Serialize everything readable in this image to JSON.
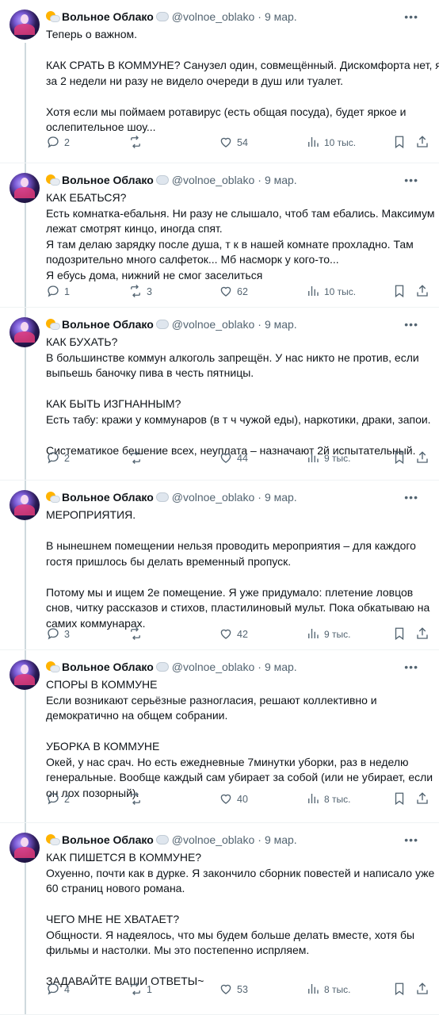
{
  "tweets": [
    {
      "author": "Вольное Облако",
      "handle": "@volnoe_oblako",
      "sep": "·",
      "date": "9 мар.",
      "lines": [
        "Теперь о важном.",
        "",
        "КАК СРАТЬ В КОММУНЕ? Санузел один, совмещённый. Дискомфорта нет, я",
        "за 2 недели ни разу не видело очереди в душ или туалет.",
        "",
        "Хотя если мы поймаем ротавирус (есть общая посуда), будет яркое и",
        "ослепительное шоу..."
      ],
      "replies": "2",
      "retweets": "",
      "likes": "54",
      "views": "10 тыс."
    },
    {
      "author": "Вольное Облако",
      "handle": "@volnoe_oblako",
      "sep": "·",
      "date": "9 мар.",
      "lines": [
        "КАК ЕБАТЬСЯ?",
        "Есть комнатка-ебальня. Ни разу не слышало, чтоб там ебались. Максимум",
        "лежат смотрят кинцо, иногда спят.",
        "Я там делаю зарядку после душа, т к в нашей комнате прохладно. Там",
        "подозрительно много салфеток... Мб насморк у кого-то...",
        "Я ебусь дома, нижний не смог заселиться"
      ],
      "replies": "1",
      "retweets": "3",
      "likes": "62",
      "views": "10 тыс."
    },
    {
      "author": "Вольное Облако",
      "handle": "@volnoe_oblako",
      "sep": "·",
      "date": "9 мар.",
      "lines": [
        "КАК БУХАТЬ?",
        "В большинстве коммун алкоголь запрещён. У нас никто не против, если",
        "выпьешь баночку пива в честь пятницы.",
        "",
        "КАК БЫТЬ ИЗГНАННЫМ?",
        "Есть  табу: кражи у коммунаров (в т ч чужой еды), наркотики, драки, запои.",
        "",
        "Систематикое бешение всех, неуплата – назначают 2й испытательный."
      ],
      "replies": "2",
      "retweets": "",
      "likes": "44",
      "views": "9 тыс."
    },
    {
      "author": "Вольное Облако",
      "handle": "@volnoe_oblako",
      "sep": "·",
      "date": "9 мар.",
      "lines": [
        "МЕРОПРИЯТИЯ.",
        "",
        "В нынешнем помещении нельзя проводить мероприятия – для каждого",
        "гостя пришлось бы делать временный пропуск.",
        "",
        "Потому мы и ищем 2е помещение. Я уже придумало: плетение ловцов",
        "снов, читку рассказов и стихов, пластилиновый мульт. Пока обкатываю на",
        "самих коммунарах."
      ],
      "replies": "3",
      "retweets": "",
      "likes": "42",
      "views": "9 тыс."
    },
    {
      "author": "Вольное Облако",
      "handle": "@volnoe_oblako",
      "sep": "·",
      "date": "9 мар.",
      "lines": [
        "СПОРЫ В КОММУНЕ",
        "Если возникают серьёзные разногласия, решают коллективно и",
        "демократично на общем собрании.",
        "",
        "УБОРКА В КОММУНЕ",
        "Окей, у нас срач. Но  есть ежедневные 7минутки уборки, раз в неделю",
        "генеральные. Вообще каждый сам убирает за собой (или не убирает, если",
        "он лох позорный)."
      ],
      "replies": "2",
      "retweets": "",
      "likes": "40",
      "views": "8 тыс."
    },
    {
      "author": "Вольное Облако",
      "handle": "@volnoe_oblako",
      "sep": "·",
      "date": "9 мар.",
      "lines": [
        "КАК ПИШЕТСЯ В КОММУНЕ?",
        "Охуенно, почти как в дурке. Я закончило сборник повестей и написало уже",
        "60 страниц нового романа.",
        "",
        "ЧЕГО МНЕ НЕ ХВАТАЕТ?",
        "Общности. Я надеялось, что мы будем больше делать вместе, хотя бы",
        "фильмы и настолки. Мы это постепенно испрляем.",
        "",
        "ЗАДАВАЙТЕ ВАШИ ОТВЕТЫ~"
      ],
      "replies": "4",
      "retweets": "1",
      "likes": "53",
      "views": "8 тыс."
    }
  ]
}
